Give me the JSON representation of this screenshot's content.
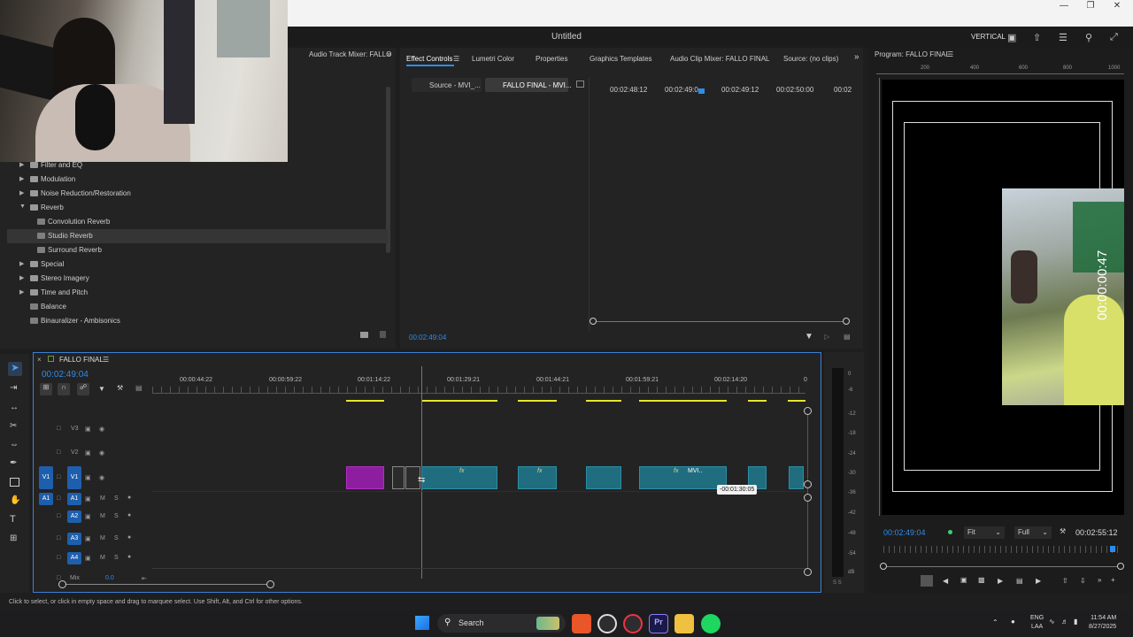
{
  "app": {
    "title": "Untitled",
    "workspace": "VERTICAL"
  },
  "panels": {
    "audio_track_mixer_tab": "Audio Track Mixer: FALLO",
    "effect_tabs": [
      "Effect Controls",
      "Lumetri Color",
      "Properties",
      "Graphics Templates",
      "Audio Clip Mixer: FALLO FINAL",
      "Source: (no clips)"
    ],
    "program_title": "Program: FALLO FINAL"
  },
  "effects_tree": [
    {
      "label": "Filter and EQ",
      "type": "folder",
      "expanded": false
    },
    {
      "label": "Modulation",
      "type": "folder",
      "expanded": false
    },
    {
      "label": "Noise Reduction/Restoration",
      "type": "folder",
      "expanded": false
    },
    {
      "label": "Reverb",
      "type": "folder",
      "expanded": true
    },
    {
      "label": "Convolution Reverb",
      "type": "effect"
    },
    {
      "label": "Studio Reverb",
      "type": "effect",
      "selected": true
    },
    {
      "label": "Surround Reverb",
      "type": "effect"
    },
    {
      "label": "Special",
      "type": "folder",
      "expanded": false
    },
    {
      "label": "Stereo Imagery",
      "type": "folder",
      "expanded": false
    },
    {
      "label": "Time and Pitch",
      "type": "folder",
      "expanded": false
    },
    {
      "label": "Balance",
      "type": "effect-root"
    },
    {
      "label": "Binauralizer - Ambisonics",
      "type": "effect-root"
    }
  ],
  "effect_controls": {
    "source_tab": "Source - MVI_...",
    "sequence_tab": "FALLO FINAL - MVI...",
    "ruler": [
      "00:02:48:12",
      "00:02:49:0",
      "00:02:49:12",
      "00:02:50:00",
      "00:02"
    ],
    "timecode": "00:02:49:04"
  },
  "program": {
    "ruler": [
      "200",
      "400",
      "600",
      "800",
      "1000"
    ],
    "overlay_timecode": "00:00:00:47",
    "timecode": "00:02:49:04",
    "fit": "Fit",
    "quality": "Full",
    "duration": "00:02:55:12"
  },
  "timeline": {
    "sequence_name": "FALLO FINAL",
    "timecode": "00:02:49:04",
    "ruler": [
      "00:00:44:22",
      "00:00:59:22",
      "00:01:14:22",
      "00:01:29:21",
      "00:01:44:21",
      "00:01:59:21",
      "00:02:14:20",
      "0"
    ],
    "tracks": [
      {
        "name": "V3",
        "kind": "video"
      },
      {
        "name": "V2",
        "kind": "video"
      },
      {
        "name": "V1",
        "kind": "video",
        "source": "V1"
      },
      {
        "name": "A1",
        "kind": "audio",
        "source": "A1"
      },
      {
        "name": "A2",
        "kind": "audio"
      },
      {
        "name": "A3",
        "kind": "audio"
      },
      {
        "name": "A4",
        "kind": "audio"
      }
    ],
    "mix_label": "Mix",
    "mix_value": "0.0",
    "tooltip": "-00:01:30:05",
    "clip_label": "MVI..",
    "fx_label": "fx",
    "vu_scale": [
      "0",
      "-6",
      "-12",
      "-18",
      "-24",
      "-30",
      "-36",
      "-42",
      "-48",
      "-54",
      "dB"
    ],
    "vu_bottom": "S S"
  },
  "status_bar": "Click to select, or click in empty space and drag to marquee select. Use Shift, Alt, and Ctrl for other options.",
  "taskbar": {
    "search_placeholder": "Search",
    "lang": "ENG",
    "region": "LAA",
    "time": "11:54 AM",
    "date": "8/27/2025"
  },
  "colors": {
    "accent_blue": "#2d8ceb",
    "clip_teal": "#1f6d7f",
    "clip_purple": "#8e1ea0",
    "yellow_line": "#e6e62e"
  }
}
